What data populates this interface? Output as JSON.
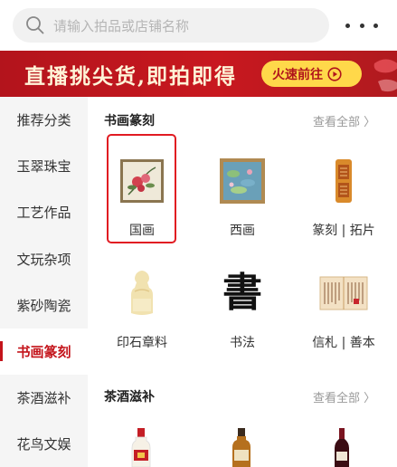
{
  "search": {
    "placeholder": "请输入拍品或店铺名称",
    "icon": "search-icon"
  },
  "header": {
    "more_icon": "more-dots-icon"
  },
  "banner": {
    "title": "直播挑尖货,即拍即得",
    "cta_label": "火速前往",
    "cta_icon": "play-circle-icon",
    "bg_color": "#c4141b",
    "cta_color": "#ffd84a"
  },
  "sidebar": {
    "items": [
      {
        "label": "推荐分类",
        "active": false
      },
      {
        "label": "玉翠珠宝",
        "active": false
      },
      {
        "label": "工艺作品",
        "active": false
      },
      {
        "label": "文玩杂项",
        "active": false
      },
      {
        "label": "紫砂陶瓷",
        "active": false
      },
      {
        "label": "书画篆刻",
        "active": true
      },
      {
        "label": "茶酒滋补",
        "active": false
      },
      {
        "label": "花鸟文娱",
        "active": false
      }
    ]
  },
  "sections": [
    {
      "title": "书画篆刻",
      "more": "查看全部 〉",
      "items": [
        {
          "label": "国画",
          "icon": "chinese-painting-thumb",
          "selected": true
        },
        {
          "label": "西画",
          "icon": "western-painting-thumb",
          "selected": false
        },
        {
          "label": "篆刻 | 拓片",
          "icon": "seal-stamp-thumb",
          "selected": false
        },
        {
          "label": "印石章料",
          "icon": "seal-stone-thumb",
          "selected": false
        },
        {
          "label": "书法",
          "icon": "calligraphy-thumb",
          "glyph": "書",
          "selected": false
        },
        {
          "label": "信札 | 善本",
          "icon": "letter-manuscript-thumb",
          "selected": false
        }
      ]
    },
    {
      "title": "茶酒滋补",
      "more": "查看全部 〉",
      "items": [
        {
          "icon": "baijiu-bottle-thumb"
        },
        {
          "icon": "whisky-bottle-thumb"
        },
        {
          "icon": "wine-bottle-thumb"
        }
      ]
    }
  ]
}
